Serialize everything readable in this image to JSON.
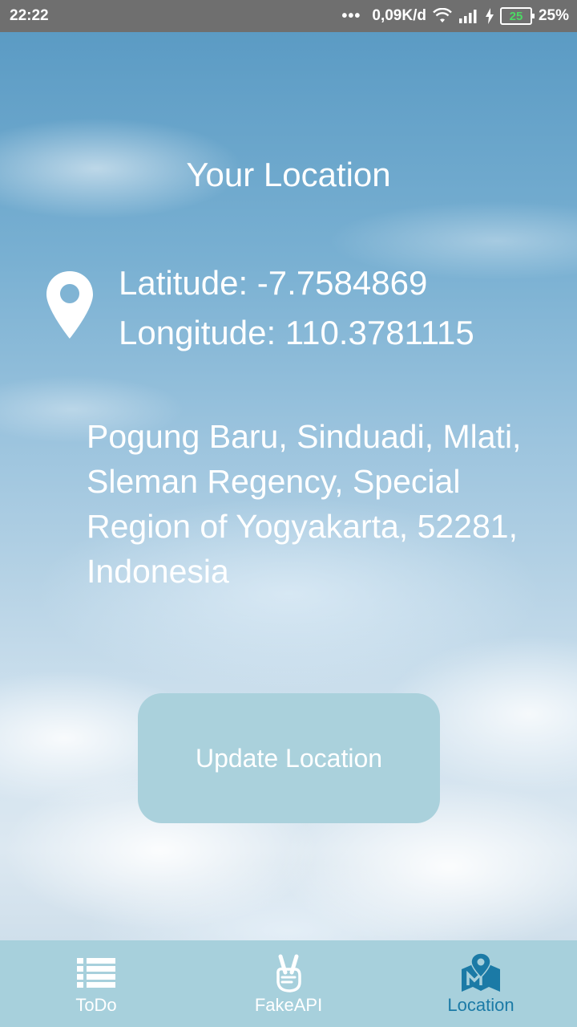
{
  "status_bar": {
    "time": "22:22",
    "dots": "•••",
    "speed": "0,09K/d",
    "battery_level": "25",
    "battery_percent": "25%",
    "icons": [
      "wifi-icon",
      "signal-icon",
      "charging-icon",
      "battery-icon"
    ]
  },
  "main": {
    "title": "Your Location",
    "latitude": "Latitude: -7.7584869",
    "longitude": "Longitude: 110.3781115",
    "address": "Pogung Baru, Sinduadi, Mlati, Sleman Regency, Special Region of Yogyakarta, 52281, Indonesia",
    "update_button": "Update Location",
    "icon": "location-pin-icon"
  },
  "nav": {
    "items": [
      {
        "label": "ToDo",
        "icon": "list-icon",
        "active": false
      },
      {
        "label": "FakeAPI",
        "icon": "peace-hand-icon",
        "active": false
      },
      {
        "label": "Location",
        "icon": "map-location-icon",
        "active": true
      }
    ]
  },
  "colors": {
    "status_bar_bg": "#6f6f6f",
    "button_bg": "#aad1dc",
    "nav_bg": "#a7d0dc",
    "nav_active": "#1b7aa6",
    "battery_text": "#4cd964"
  }
}
